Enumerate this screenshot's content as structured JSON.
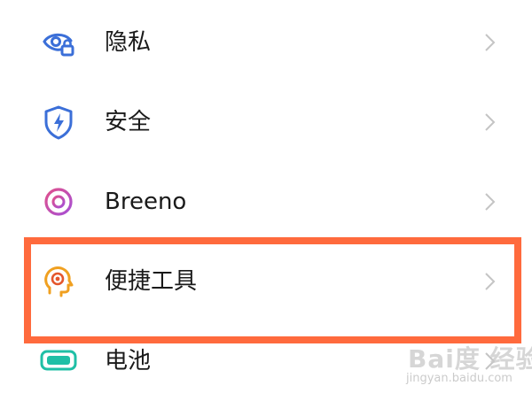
{
  "settings": {
    "items": [
      {
        "label": "隐私",
        "icon": "privacy-eye-lock-icon",
        "color": "#3b6fd8"
      },
      {
        "label": "安全",
        "icon": "security-shield-bolt-icon",
        "color": "#3b6fd8"
      },
      {
        "label": "Breeno",
        "icon": "breeno-ring-icon",
        "color": "#d24fa8"
      },
      {
        "label": "便捷工具",
        "icon": "convenience-tools-head-icon",
        "color": "#f0a020"
      },
      {
        "label": "电池",
        "icon": "battery-icon",
        "color": "#1fbfa6"
      }
    ]
  },
  "highlight": {
    "color": "#ff6a3d"
  },
  "watermark": {
    "logo": "Bai度 经验",
    "url": "jingyan.baidu.com"
  }
}
